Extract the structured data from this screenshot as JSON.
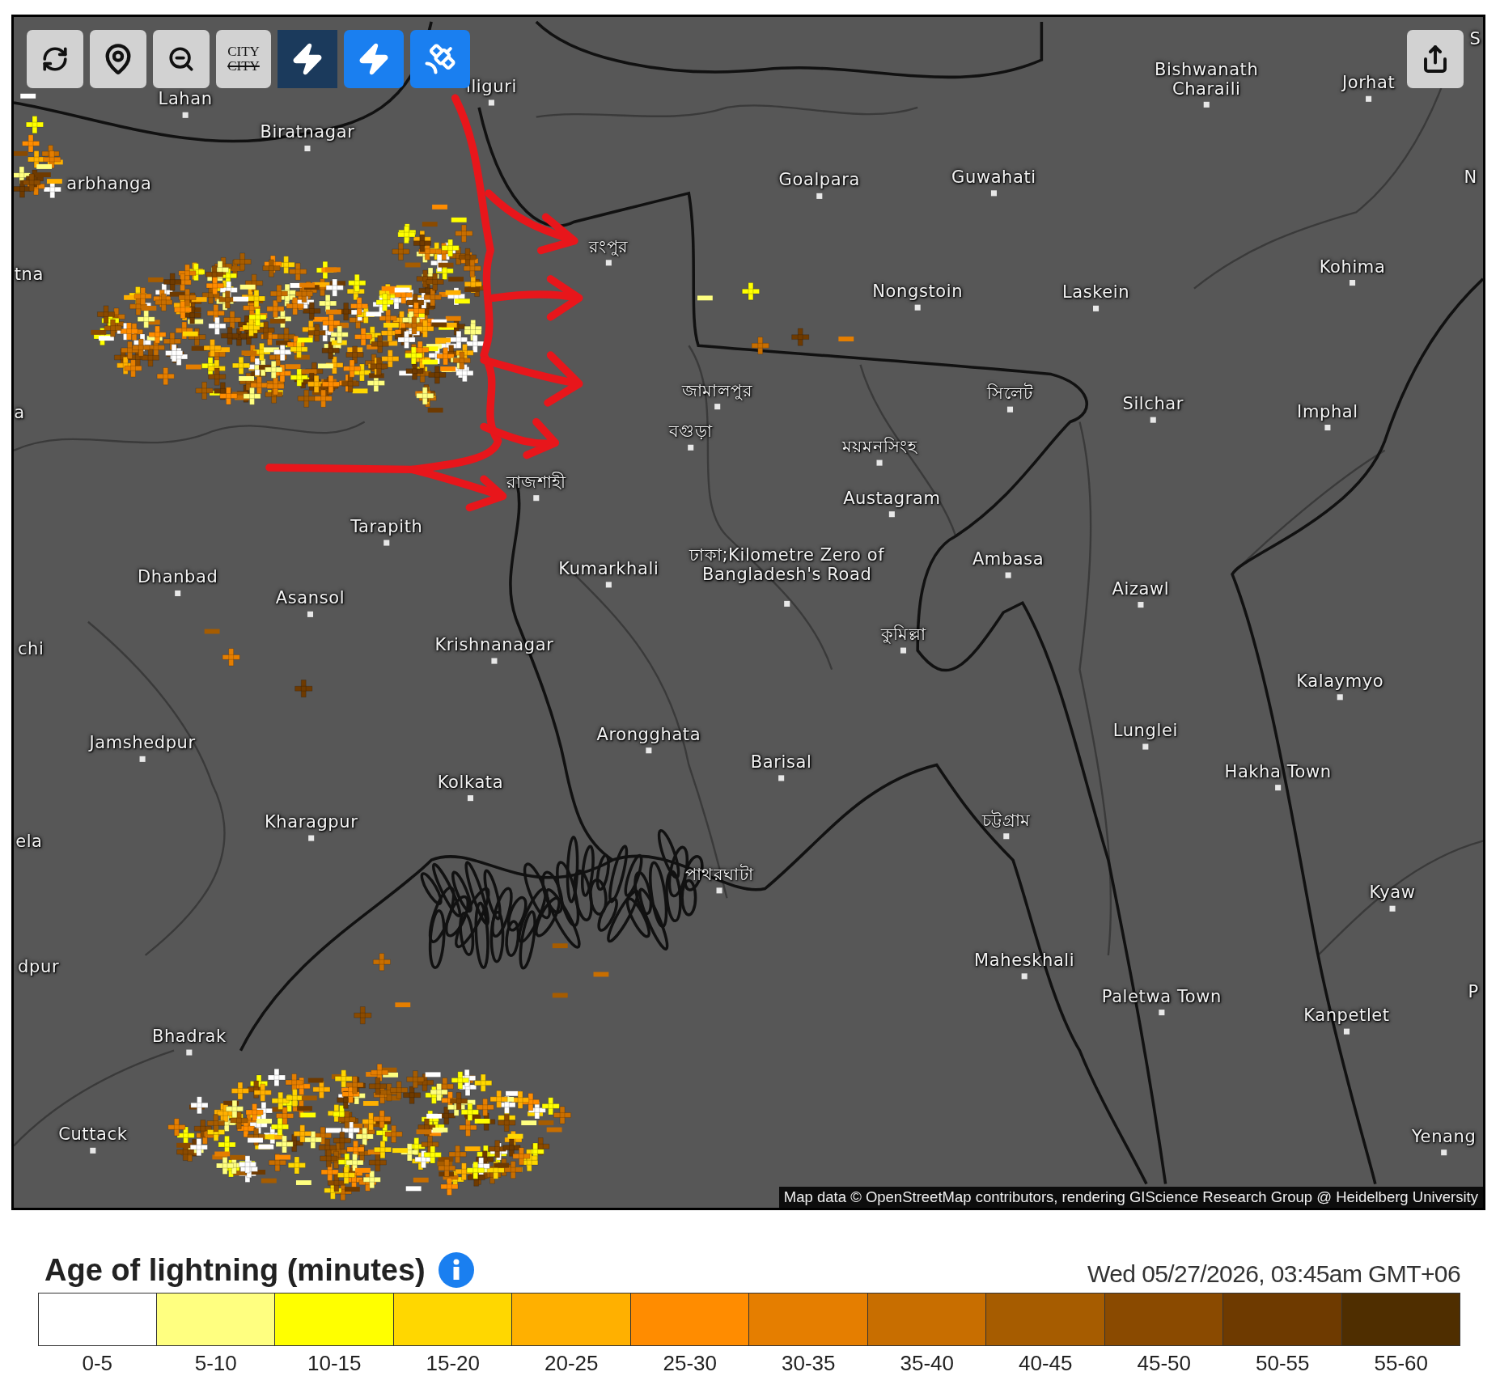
{
  "map": {
    "toolbar": [
      {
        "kind": "refresh"
      },
      {
        "kind": "locate"
      },
      {
        "kind": "zoom_out"
      },
      {
        "kind": "city_labels",
        "lines": [
          "CITY",
          "CITY"
        ]
      },
      {
        "kind": "strikes",
        "active": false
      },
      {
        "kind": "ground_strikes",
        "active": true
      },
      {
        "kind": "satellite",
        "active": true
      },
      {
        "kind": "share"
      }
    ],
    "labels": [
      "Lahan",
      "iliguri",
      "Biratnagar",
      "arbhanga",
      "tna",
      "Goalpara",
      "Guwahati",
      "Bishwanath Charaili",
      "Jorhat",
      "S",
      "N",
      "Kohima",
      "Nongstoin",
      "Laskein",
      "রংপুর",
      "a",
      "জামালপুর",
      "বগুড়া",
      "ময়মনসিংহ",
      "সিলেট",
      "Silchar",
      "Imphal",
      "রাজশাহী",
      "Austagram",
      "Tarapith",
      "Dhanbad",
      "Asansol",
      "Kumarkhali",
      "ঢাকা;Kilometre Zero of Bangladesh's Road",
      "Ambasa",
      "Aizawl",
      "কুমিল্লা",
      "chi",
      "Krishnanagar",
      "Kalaymyo",
      "Jamshedpur",
      "Arongghata",
      "Lunglei",
      "Barisal",
      "Hakha Town",
      "Kolkata",
      "Kharagpur",
      "ela",
      "চট্টগ্রাম",
      "পাথরঘাটা",
      "Kyaw",
      "dpur",
      "Maheskhali",
      "Paletwa Town",
      "P",
      "Kanpetlet",
      "Bhadrak",
      "Cuttack",
      "Yenang"
    ],
    "attribution": "Map data © OpenStreetMap contributors, rendering GIScience Research Group @ Heidelberg University"
  },
  "legend": {
    "title": "Age of lightning (minutes)",
    "timestamp": "Wed 05/27/2026, 03:45am GMT+06",
    "bins": [
      {
        "label": "0-5",
        "color": "#ffffff"
      },
      {
        "label": "5-10",
        "color": "#ffff80"
      },
      {
        "label": "10-15",
        "color": "#ffff00"
      },
      {
        "label": "15-20",
        "color": "#ffd700"
      },
      {
        "label": "20-25",
        "color": "#ffb000"
      },
      {
        "label": "25-30",
        "color": "#ff8c00"
      },
      {
        "label": "30-35",
        "color": "#e57e00"
      },
      {
        "label": "35-40",
        "color": "#c86e00"
      },
      {
        "label": "40-45",
        "color": "#a65c00"
      },
      {
        "label": "45-50",
        "color": "#8a4a00"
      },
      {
        "label": "50-55",
        "color": "#6e3a00"
      },
      {
        "label": "55-60",
        "color": "#4f2e00"
      }
    ]
  }
}
